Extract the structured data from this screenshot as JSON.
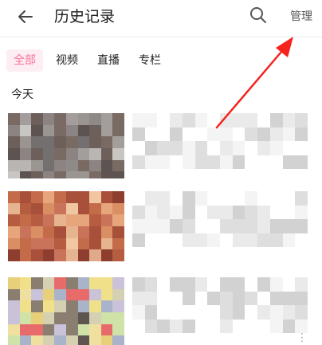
{
  "header": {
    "title": "历史记录",
    "manage_label": "管理",
    "back_icon": "back-arrow-icon",
    "search_icon": "search-icon"
  },
  "tabs": [
    {
      "label": "全部",
      "active": true
    },
    {
      "label": "视频",
      "active": false
    },
    {
      "label": "直播",
      "active": false
    },
    {
      "label": "专栏",
      "active": false
    }
  ],
  "section": {
    "label": "今天"
  },
  "colors": {
    "accent": "#fb7299",
    "accent_bg": "#fdeef3",
    "annotation_arrow": "#f5221d"
  },
  "history": {
    "items": [
      {
        "thumbnail_palette": [
          "#9a9590",
          "#6d605a",
          "#8c8482",
          "#b9b5b2",
          "#7a6a64",
          "#a39e9b",
          "#5d5350",
          "#c9c5c2",
          "#8f8a87",
          "#747070"
        ]
      },
      {
        "thumbnail_palette": [
          "#e0a98a",
          "#c9745a",
          "#b65c40",
          "#e6b48f",
          "#a8503a",
          "#d98e63",
          "#f0c7a0",
          "#c46b4a",
          "#8e3e2e",
          "#e7a57b"
        ]
      },
      {
        "thumbnail_palette": [
          "#cfe3a8",
          "#e86b6b",
          "#c9c2d9",
          "#f0e08a",
          "#8a7e70",
          "#d6d0b2",
          "#5c5550",
          "#efe0a0",
          "#a9b3c9",
          "#e8d07a"
        ]
      }
    ]
  }
}
